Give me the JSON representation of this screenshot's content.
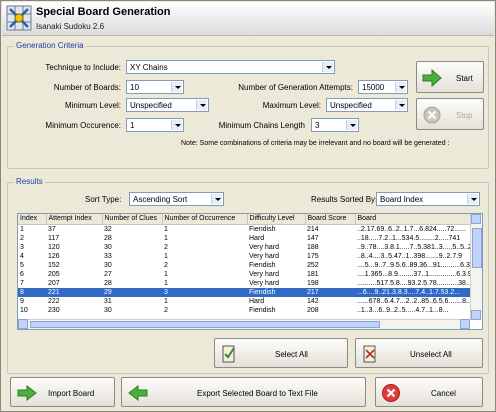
{
  "window": {
    "title": "Special Board Generation",
    "subtitle": "Isanaki Sudoku 2.6"
  },
  "criteria": {
    "group_label": "Generation Criteria",
    "technique_label": "Technique to Include:",
    "technique_value": "XY Chains",
    "num_boards_label": "Number of Boards:",
    "num_boards_value": "10",
    "attempts_label": "Number of Generation Attempts:",
    "attempts_value": "15000",
    "min_level_label": "Minimum Level:",
    "min_level_value": "Unspecified",
    "max_level_label": "Maximum Level:",
    "max_level_value": "Unspecified",
    "min_occurence_label": "Minimum Occurence:",
    "min_occurence_value": "1",
    "min_chains_label": "Minimum Chains Length",
    "min_chains_value": "3",
    "note": "Note: Some combinations of criteria may be irrelevant and no board will be generated :",
    "start_label": "Start",
    "stop_label": "Stop"
  },
  "results": {
    "group_label": "Results",
    "sort_type_label": "Sort Type:",
    "sort_type_value": "Ascending Sort",
    "sorted_by_label": "Results Sorted By:",
    "sorted_by_value": "Board Index",
    "columns": [
      "Index",
      "Attempt Index",
      "Number of Clues",
      "Number of Occurrence",
      "Difficulty Level",
      "Board Score",
      "Board"
    ],
    "rows": [
      [
        "1",
        "37",
        "32",
        "1",
        "Fiendish",
        "214",
        "..2.17.69..6..2..1.7...6.824.....72......"
      ],
      [
        "2",
        "117",
        "28",
        "1",
        "Hard",
        "147",
        "..18.....7.2..1...534.5........2.....741"
      ],
      [
        "3",
        "120",
        "30",
        "2",
        "Very hard",
        "188",
        "..9..78....3.8.1.....7..5.381..3.....5..5..2"
      ],
      [
        "4",
        "126",
        "33",
        "1",
        "Very hard",
        "175",
        "..8..4....3..5.47..1..398.......9..2.7.9"
      ],
      [
        "5",
        "152",
        "30",
        "2",
        "Fiendish",
        "252",
        "....5...9..7..9.5.6..89.36...91..........6.32"
      ],
      [
        "6",
        "205",
        "27",
        "1",
        "Very hard",
        "181",
        "....1.365...8.9........37..1..............6.3.98"
      ],
      [
        "7",
        "207",
        "28",
        "1",
        "Very hard",
        "198",
        "..........517.5.8....93.2.5.78...........38..."
      ],
      [
        "8",
        "221",
        "29",
        "3",
        "Fiendish",
        "217",
        "...6....9..21.3.8.3....7.4..1.7.53.2..."
      ],
      [
        "9",
        "222",
        "31",
        "1",
        "Hard",
        "142",
        "......678..6.4.7...2..2..85..6.5.6.......8..7"
      ],
      [
        "10",
        "230",
        "30",
        "2",
        "Fiendish",
        "208",
        "..1..3...6..9..2..5.....4.7..1...8..."
      ]
    ],
    "selected_row": 7,
    "select_all_label": "Select All",
    "unselect_all_label": "Unselect All"
  },
  "footer": {
    "import_label": "Import Board",
    "export_label": "Export Selected Board to Text File",
    "cancel_label": "Cancel"
  }
}
